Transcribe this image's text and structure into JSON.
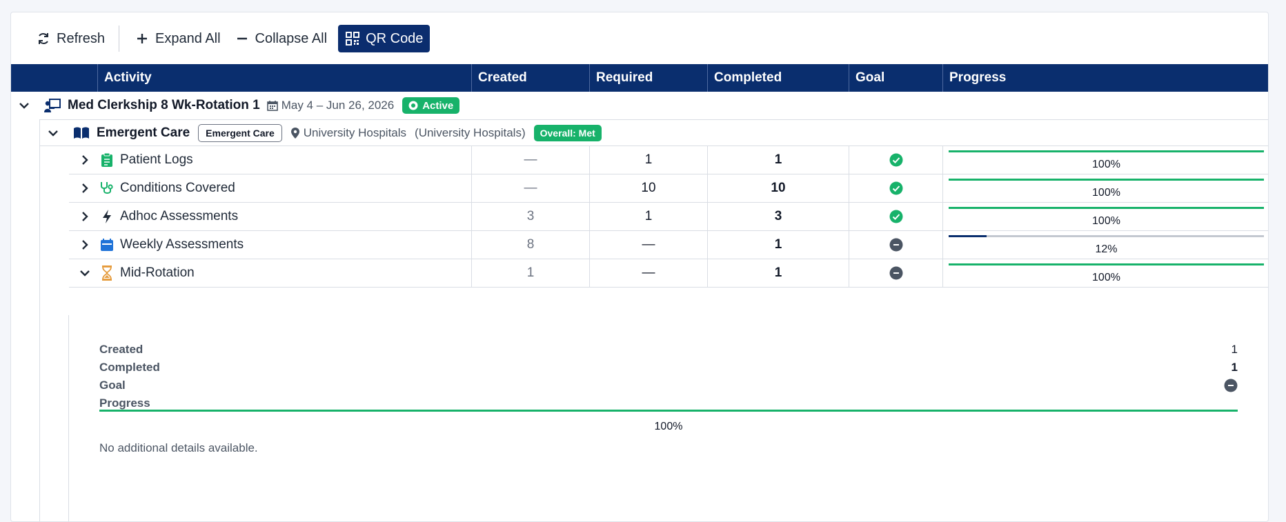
{
  "toolbar": {
    "refresh_label": "Refresh",
    "expand_label": "Expand All",
    "collapse_label": "Collapse All",
    "qr_label": "QR Code"
  },
  "columns": {
    "activity": "Activity",
    "created": "Created",
    "required": "Required",
    "completed": "Completed",
    "goal": "Goal",
    "progress": "Progress"
  },
  "rotation": {
    "title": "Med Clerkship 8 Wk-Rotation 1",
    "dates": "May 4 – Jun 26, 2026",
    "status": "Active"
  },
  "block": {
    "title": "Emergent Care",
    "tag": "Emergent Care",
    "location": "University Hospitals",
    "location_paren": "(University Hospitals)",
    "overall": "Overall: Met"
  },
  "activities": [
    {
      "name": "Patient Logs",
      "icon": "clipboard-icon",
      "created": "—",
      "required": "1",
      "completed": "1",
      "goal": "met",
      "progress": 100,
      "progress_label": "100%",
      "expanded": false
    },
    {
      "name": "Conditions Covered",
      "icon": "stethoscope-icon",
      "created": "—",
      "required": "10",
      "completed": "10",
      "goal": "met",
      "progress": 100,
      "progress_label": "100%",
      "expanded": false
    },
    {
      "name": "Adhoc Assessments",
      "icon": "bolt-icon",
      "created": "3",
      "required": "1",
      "completed": "3",
      "goal": "met",
      "progress": 100,
      "progress_label": "100%",
      "expanded": false
    },
    {
      "name": "Weekly Assessments",
      "icon": "calendar-icon",
      "created": "8",
      "required": "—",
      "completed": "1",
      "goal": "none",
      "progress": 12,
      "progress_label": "12%",
      "expanded": false
    },
    {
      "name": "Mid-Rotation",
      "icon": "hourglass-icon",
      "created": "1",
      "required": "—",
      "completed": "1",
      "goal": "none",
      "progress": 100,
      "progress_label": "100%",
      "expanded": true
    }
  ],
  "detail": {
    "created_label": "Created",
    "created_value": "1",
    "completed_label": "Completed",
    "completed_value": "1",
    "goal_label": "Goal",
    "progress_label": "Progress",
    "progress": 100,
    "progress_text": "100%",
    "note": "No additional details available."
  },
  "colors": {
    "header_bg": "#0a2e6e",
    "success": "#17b26a",
    "neutral": "#4b5563",
    "progress_partial": "#0a2e6e"
  }
}
